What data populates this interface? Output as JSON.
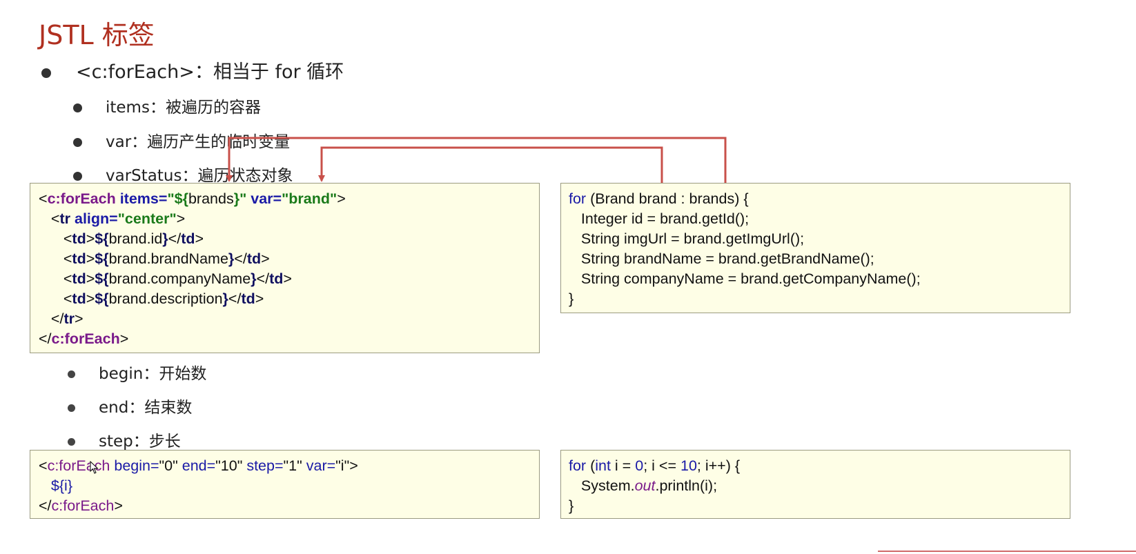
{
  "title": "JSTL 标签",
  "bullets": {
    "foreach": "<c:forEach>：相当于 for 循环",
    "items": "items：被遍历的容器",
    "var": "var：遍历产生的临时变量",
    "varStatus": "varStatus：遍历状态对象",
    "begin": "begin：开始数",
    "end": "end：结束数",
    "step": "step：步长"
  },
  "jsp_code_1": {
    "l1_open": "<",
    "l1_tag": "c:forEach",
    "l1_attr1": " items=",
    "l1_val1_a": "\"${",
    "l1_val1_b": "brands",
    "l1_val1_c": "}\"",
    "l1_attr2": " var=",
    "l1_val2": "\"brand\"",
    "l1_close": ">",
    "l2_open": "<",
    "l2_tag": "tr",
    "l2_attr": " align=",
    "l2_val": "\"center\"",
    "l2_close": ">",
    "td_rows": [
      {
        "expr_open": "${",
        "expr": "brand.id",
        "expr_close": "}"
      },
      {
        "expr_open": "${",
        "expr": "brand.brandName",
        "expr_close": "}"
      },
      {
        "expr_open": "${",
        "expr": "brand.companyName",
        "expr_close": "}"
      },
      {
        "expr_open": "${",
        "expr": "brand.description",
        "expr_close": "}"
      }
    ],
    "td": "td",
    "tr_end": "tr",
    "foreach_end": "c:forEach"
  },
  "java_code_1": {
    "line1_kw": "for",
    "line1_rest": " (Brand brand : brands) {",
    "line2": "Integer id = brand.getId();",
    "line3": "String imgUrl = brand.getImgUrl();",
    "line4": "String brandName = brand.getBrandName();",
    "line5": "String companyName = brand.getCompanyName();",
    "line6": "}"
  },
  "jsp_code_2": {
    "l1_a": "<",
    "l1_tag": "c:forEach",
    "l1_b": " begin=",
    "l1_v1": "\"0\"",
    "l1_c": " end=",
    "l1_v2": "\"10\"",
    "l1_d": " step=",
    "l1_v3": "\"1\"",
    "l1_e": " var=",
    "l1_v4": "\"i\"",
    "l1_f": ">",
    "l2": "${i}",
    "l3_a": "</",
    "l3_tag": "c:forEach",
    "l3_b": ">"
  },
  "java_code_2": {
    "l1_kw": "for",
    "l1_a": " (",
    "l1_int": "int",
    "l1_b": " i = ",
    "l1_n0": "0",
    "l1_c": "; i <= ",
    "l1_n10": "10",
    "l1_d": "; i++) {",
    "l2_a": "System.",
    "l2_out": "out",
    "l2_b": ".println(i);",
    "l3": "}"
  },
  "colors": {
    "title": "#b03020",
    "code_bg": "#fefee6",
    "arrow": "#c8504a"
  }
}
